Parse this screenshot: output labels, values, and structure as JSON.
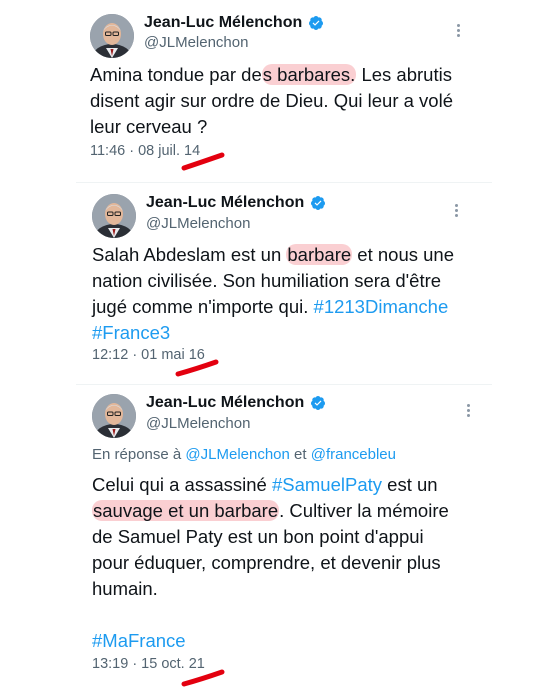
{
  "tweets": [
    {
      "author_name": "Jean-Luc Mélenchon",
      "author_handle": "@JLMelenchon",
      "reply_prefix": "",
      "reply_mention_1": "",
      "reply_and": "",
      "reply_mention_2": "",
      "body": {
        "l1a": "Amina tondue par de",
        "l1hl": "s barbares.",
        "l1b": " Les abrutis",
        "l2": "disent agir sur ordre de Dieu. Qui leur a volé",
        "l3": "leur cerveau ?"
      },
      "timestamp": "11:46 · 08 juil. 14"
    },
    {
      "author_name": "Jean-Luc Mélenchon",
      "author_handle": "@JLMelenchon",
      "body": {
        "l1a": "Salah Abdeslam est un ",
        "l1hl": "barbare",
        "l1b": " et nous une",
        "l2": "nation civilisée. Son humiliation sera d'être",
        "l3a": "jugé comme n'importe qui. ",
        "l3tag": "#1213Dimanche",
        "l4tag": "#France3"
      },
      "timestamp": "12:12 · 01 mai 16"
    },
    {
      "author_name": "Jean-Luc Mélenchon",
      "author_handle": "@JLMelenchon",
      "reply_prefix": "En réponse à ",
      "reply_mention_1": "@JLMelenchon",
      "reply_and": " et ",
      "reply_mention_2": "@francebleu",
      "body": {
        "l1a": "Celui qui a assassiné ",
        "l1tag": "#SamuelPaty",
        "l1b": " est un",
        "l2hl": "sauvage et un barbare",
        "l2b": ". Cultiver la mémoire",
        "l3": "de Samuel Paty est un bon point d'appui",
        "l4": "pour éduquer, comprendre, et devenir plus",
        "l5": "humain.",
        "l6tag": "#MaFrance"
      },
      "timestamp": "13:19 · 15 oct. 21"
    }
  ],
  "colors": {
    "accent": "#1d9bf0",
    "highlight": "#f4949c",
    "annotation": "#e3000f",
    "muted": "#536471"
  }
}
